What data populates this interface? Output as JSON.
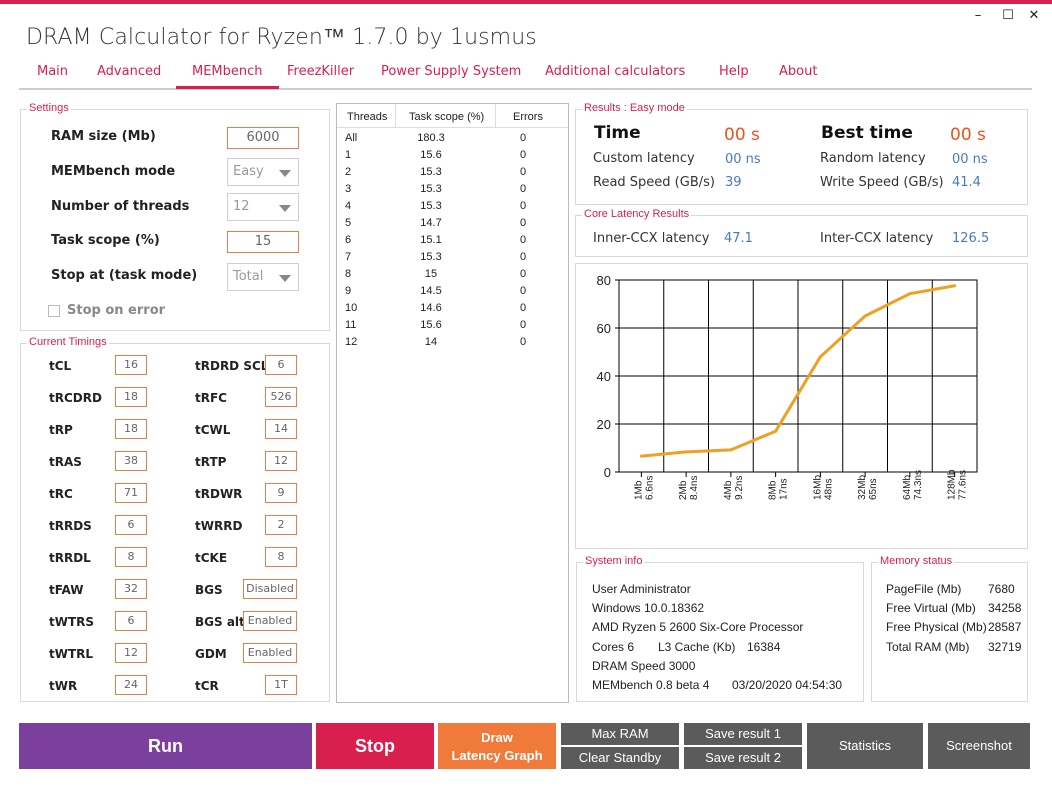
{
  "window": {
    "title": "DRAM Calculator for Ryzen™ 1.7.0 by 1usmus",
    "minimize": "–",
    "maximize": "☐",
    "close": "✕"
  },
  "menu": [
    "Main",
    "Advanced",
    "MEMbench",
    "FreezKiller",
    "Power Supply System",
    "Additional calculators",
    "Help",
    "About"
  ],
  "settings": {
    "title": "Settings",
    "ram_size_label": "RAM size (Mb)",
    "ram_size_value": "6000",
    "mode_label": "MEMbench mode",
    "mode_value": "Easy",
    "threads_label": "Number of threads",
    "threads_value": "12",
    "scope_label": "Task scope (%)",
    "scope_value": "15",
    "stop_label": "Stop at (task mode)",
    "stop_value": "Total",
    "stop_on_error": "Stop on error"
  },
  "timings": {
    "title": "Current Timings",
    "left": [
      {
        "label": "tCL",
        "value": "16"
      },
      {
        "label": "tRCDRD",
        "value": "18"
      },
      {
        "label": "tRP",
        "value": "18"
      },
      {
        "label": "tRAS",
        "value": "38"
      },
      {
        "label": "tRC",
        "value": "71"
      },
      {
        "label": "tRRDS",
        "value": "6"
      },
      {
        "label": "tRRDL",
        "value": "8"
      },
      {
        "label": "tFAW",
        "value": "32"
      },
      {
        "label": "tWTRS",
        "value": "6"
      },
      {
        "label": "tWTRL",
        "value": "12"
      },
      {
        "label": "tWR",
        "value": "24"
      }
    ],
    "right": [
      {
        "label": "tRDRD SCL",
        "value": "6"
      },
      {
        "label": "tRFC",
        "value": "526"
      },
      {
        "label": "tCWL",
        "value": "14"
      },
      {
        "label": "tRTP",
        "value": "12"
      },
      {
        "label": "tRDWR",
        "value": "9"
      },
      {
        "label": "tWRRD",
        "value": "2"
      },
      {
        "label": "tCKE",
        "value": "8"
      },
      {
        "label": "BGS",
        "value": "Disabled"
      },
      {
        "label": "BGS alt",
        "value": "Enabled"
      },
      {
        "label": "GDM",
        "value": "Enabled"
      },
      {
        "label": "tCR",
        "value": "1T"
      }
    ]
  },
  "threads_table": {
    "headers": [
      "Threads",
      "Task scope (%)",
      "Errors"
    ],
    "rows": [
      [
        "All",
        "180.3",
        "0"
      ],
      [
        "1",
        "15.6",
        "0"
      ],
      [
        "2",
        "15.3",
        "0"
      ],
      [
        "3",
        "15.3",
        "0"
      ],
      [
        "4",
        "15.3",
        "0"
      ],
      [
        "5",
        "14.7",
        "0"
      ],
      [
        "6",
        "15.1",
        "0"
      ],
      [
        "7",
        "15.3",
        "0"
      ],
      [
        "8",
        "15",
        "0"
      ],
      [
        "9",
        "14.5",
        "0"
      ],
      [
        "10",
        "14.6",
        "0"
      ],
      [
        "11",
        "15.6",
        "0"
      ],
      [
        "12",
        "14",
        "0"
      ]
    ]
  },
  "results": {
    "title": "Results : Easy mode",
    "time_label": "Time",
    "time_value": "00 s",
    "best_label": "Best time",
    "best_value": "00 s",
    "custom_label": "Custom latency",
    "custom_value": "00 ns",
    "random_label": "Random latency",
    "random_value": "00 ns",
    "read_label": "Read Speed (GB/s)",
    "read_value": "39",
    "write_label": "Write Speed (GB/s)",
    "write_value": "41.4"
  },
  "core_latency": {
    "title": "Core Latency Results",
    "inner_label": "Inner-CCX latency",
    "inner_value": "47.1",
    "inter_label": "Inter-CCX latency",
    "inter_value": "126.5"
  },
  "chart_data": {
    "type": "line",
    "categories": [
      "1Mb 6.6ns",
      "2Mb 8.4ns",
      "4Mb 9.2ns",
      "8Mb 17ns",
      "16Mb 48ns",
      "32Mb 65ns",
      "64Mb 74.3ns",
      "128Mb 77.6ns"
    ],
    "category_lines": [
      [
        "1Mb",
        "6.6ns"
      ],
      [
        "2Mb",
        "8.4ns"
      ],
      [
        "4Mb",
        "9.2ns"
      ],
      [
        "8Mb",
        "17ns"
      ],
      [
        "16Mb",
        "48ns"
      ],
      [
        "32Mb",
        "65ns"
      ],
      [
        "64Mb",
        "74.3ns"
      ],
      [
        "128Mb",
        "77.6ns"
      ]
    ],
    "values": [
      6.6,
      8.4,
      9.2,
      17,
      48,
      65,
      74.3,
      77.6
    ],
    "ylim": [
      0,
      80
    ],
    "yticks": [
      "0",
      "20",
      "40",
      "60",
      "80"
    ],
    "grid": true,
    "line_color": "#f0a020"
  },
  "system_info": {
    "title": "System info",
    "user": "User Administrator",
    "os": "Windows 10.0.18362",
    "cpu": "AMD Ryzen 5 2600 Six-Core Processor",
    "cores": "Cores 6",
    "l3": "L3 Cache (Kb)",
    "l3_value": "16384",
    "dram": "DRAM Speed 3000",
    "membench": "MEMbench 0.8 beta 4",
    "datetime": "03/20/2020 04:54:30"
  },
  "memory_status": {
    "title": "Memory status",
    "rows": [
      {
        "label": "PageFile (Mb)",
        "value": "7680"
      },
      {
        "label": "Free Virtual (Mb)",
        "value": "34258"
      },
      {
        "label": "Free Physical (Mb)",
        "value": "28587"
      },
      {
        "label": "Total RAM (Mb)",
        "value": "32719"
      }
    ]
  },
  "buttons": {
    "run": "Run",
    "stop": "Stop",
    "draw_line1": "Draw",
    "draw_line2": "Latency Graph",
    "max_ram": "Max RAM",
    "clear_standby": "Clear Standby",
    "save1": "Save result 1",
    "save2": "Save result 2",
    "statistics": "Statistics",
    "screenshot": "Screenshot"
  },
  "colors": {
    "accent": "#d81f4e",
    "run": "#7b3f9e",
    "stop": "#d81f4e",
    "draw": "#f07a3a",
    "gray_button": "#5b5b5b",
    "orange_value": "#e8541c",
    "blue_value": "#4a78c0"
  }
}
